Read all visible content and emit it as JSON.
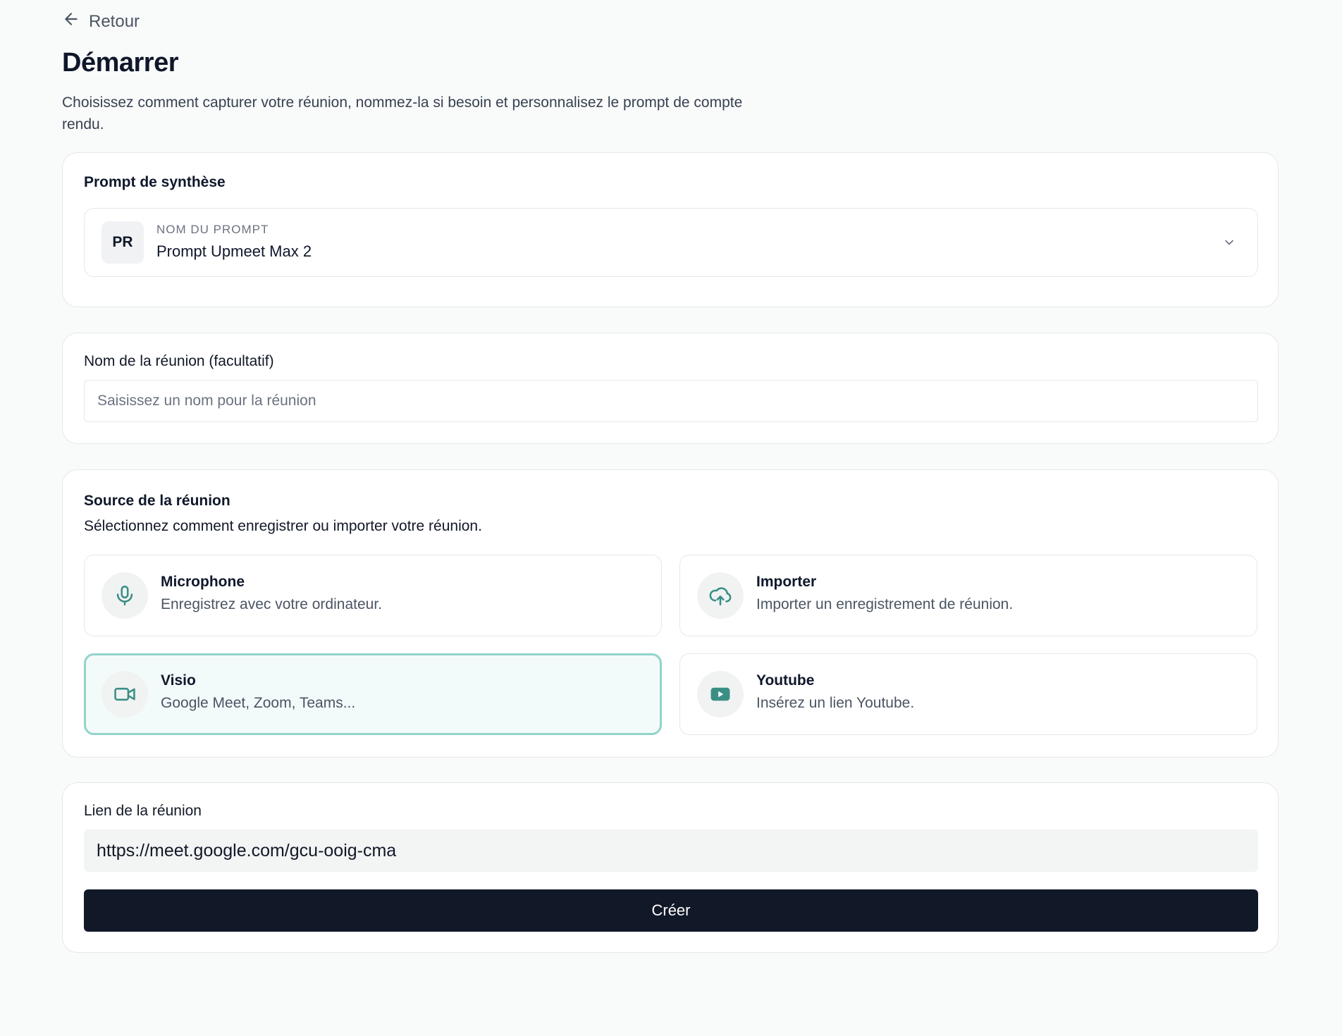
{
  "nav": {
    "back_label": "Retour"
  },
  "header": {
    "title": "Démarrer",
    "subtitle": "Choisissez comment capturer votre réunion, nommez-la si besoin et personnalisez le prompt de compte rendu."
  },
  "prompt_section": {
    "heading": "Prompt de synthèse",
    "badge": "PR",
    "caption": "NOM DU PROMPT",
    "selected_prompt": "Prompt Upmeet Max 2"
  },
  "meeting_name": {
    "label": "Nom de la réunion (facultatif)",
    "placeholder": "Saisissez un nom pour la réunion",
    "value": ""
  },
  "source_section": {
    "heading": "Source de la réunion",
    "description": "Sélectionnez comment enregistrer ou importer votre réunion.",
    "selected": "Visio",
    "options": [
      {
        "title": "Microphone",
        "description": "Enregistrez avec votre ordinateur.",
        "icon": "microphone-icon"
      },
      {
        "title": "Importer",
        "description": "Importer un enregistrement de réunion.",
        "icon": "cloud-upload-icon"
      },
      {
        "title": "Visio",
        "description": "Google Meet, Zoom, Teams...",
        "icon": "video-camera-icon"
      },
      {
        "title": "Youtube",
        "description": "Insérez un lien Youtube.",
        "icon": "youtube-icon"
      }
    ]
  },
  "link_section": {
    "label": "Lien de la réunion",
    "value": "https://meet.google.com/gcu-ooig-cma",
    "button_label": "Créer"
  },
  "colors": {
    "accent": "#3a8f85",
    "selected_border": "#93d3cb",
    "selected_bg": "#f3fbfa",
    "primary_button": "#111827"
  }
}
